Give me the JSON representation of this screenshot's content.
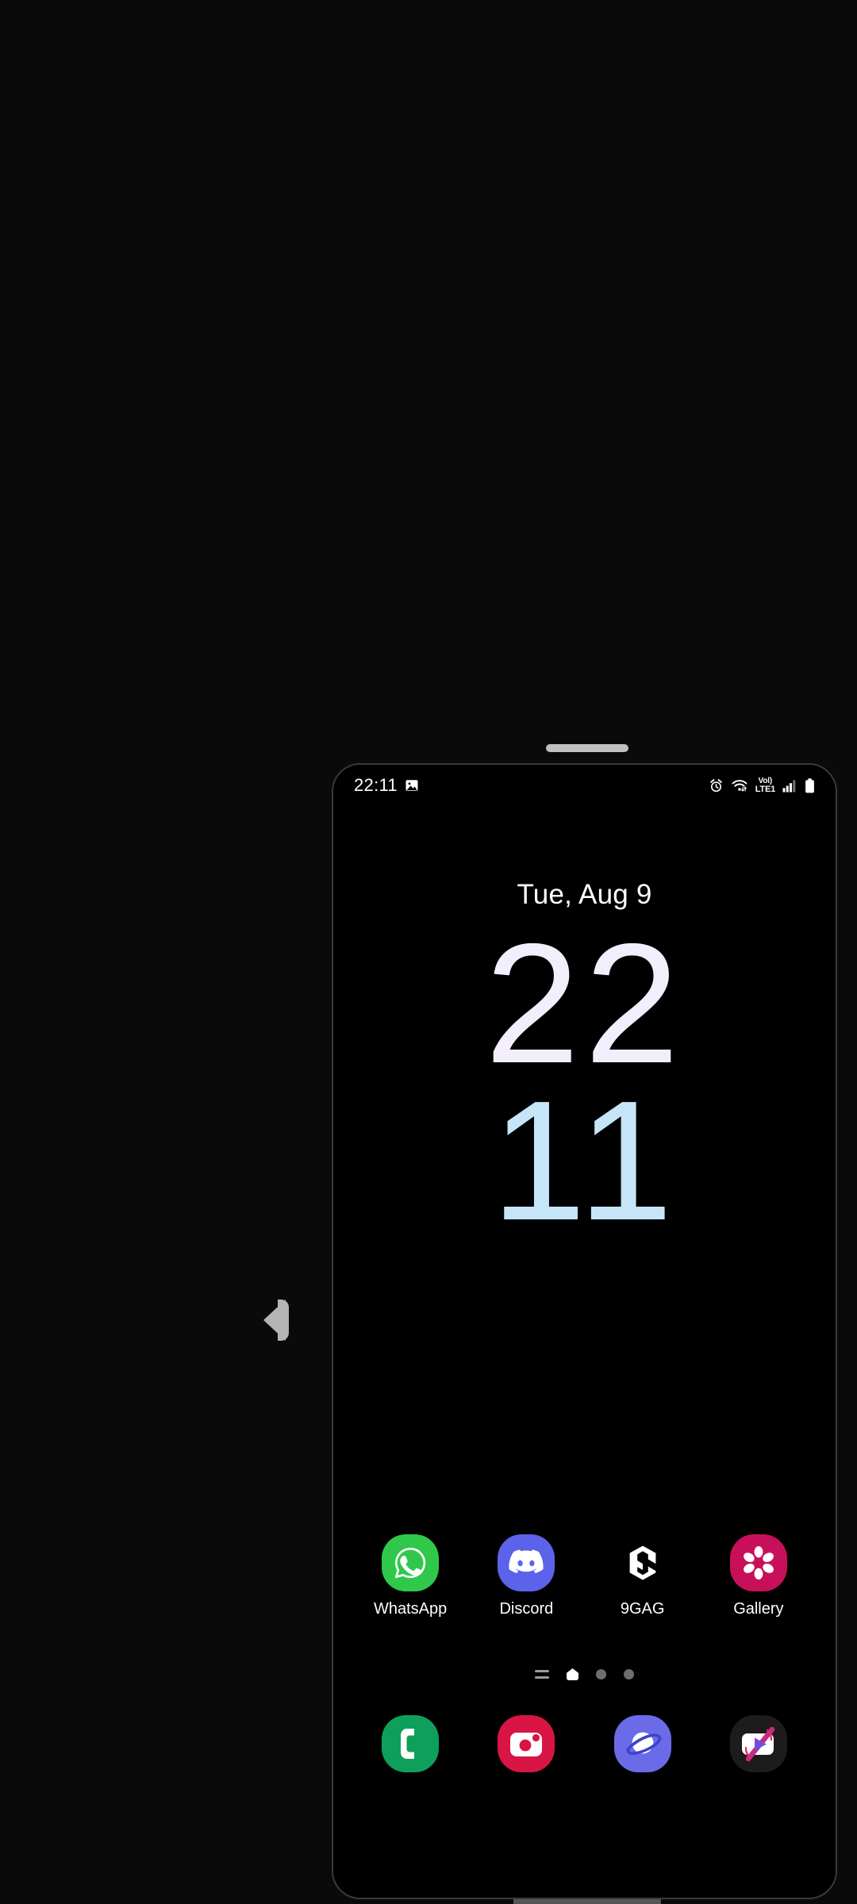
{
  "window": {
    "top_handle_name": "window-drag-handle",
    "bottom_handle_name": "window-resize-handle",
    "side_arrow_name": "edge-panel-handle"
  },
  "statusbar": {
    "time": "22:11",
    "left_icons": [
      {
        "name": "gallery-notification-icon",
        "label": "image"
      }
    ],
    "right_icons": [
      {
        "name": "alarm-icon",
        "label": "alarm"
      },
      {
        "name": "wifi-icon",
        "label": "wifi"
      },
      {
        "name": "volte-icon",
        "line1": "Vol)",
        "line2": "LTE1"
      },
      {
        "name": "signal-icon",
        "label": "signal",
        "bars_total": 4,
        "bars_active": 3
      },
      {
        "name": "battery-icon",
        "label": "battery"
      }
    ]
  },
  "clock_widget": {
    "date": "Tue, Aug 9",
    "hours": "22",
    "minutes": "11",
    "hours_color": "#f3eefb",
    "minutes_color": "#c6e5f8"
  },
  "home": {
    "apps": [
      {
        "name": "whatsapp",
        "label": "WhatsApp",
        "color": "#2fc84a"
      },
      {
        "name": "discord",
        "label": "Discord",
        "color": "#5b63ea"
      },
      {
        "name": "ninegag",
        "label": "9GAG",
        "color": "#000000"
      },
      {
        "name": "gallery",
        "label": "Gallery",
        "color": "#c8105a"
      }
    ],
    "page_indicator": {
      "items": [
        {
          "type": "lines",
          "active": false
        },
        {
          "type": "home",
          "active": true
        },
        {
          "type": "dot",
          "active": false
        },
        {
          "type": "dot",
          "active": false
        }
      ]
    },
    "dock": [
      {
        "name": "phone",
        "label": "Phone",
        "color": "#0ea05a"
      },
      {
        "name": "camera",
        "label": "Camera",
        "color": "#d81544"
      },
      {
        "name": "samsung-internet",
        "label": "Internet",
        "color": "#6b6bea"
      },
      {
        "name": "youtube-vanced",
        "label": "YouTube Vanced",
        "color": "#1d1b1e"
      }
    ]
  }
}
